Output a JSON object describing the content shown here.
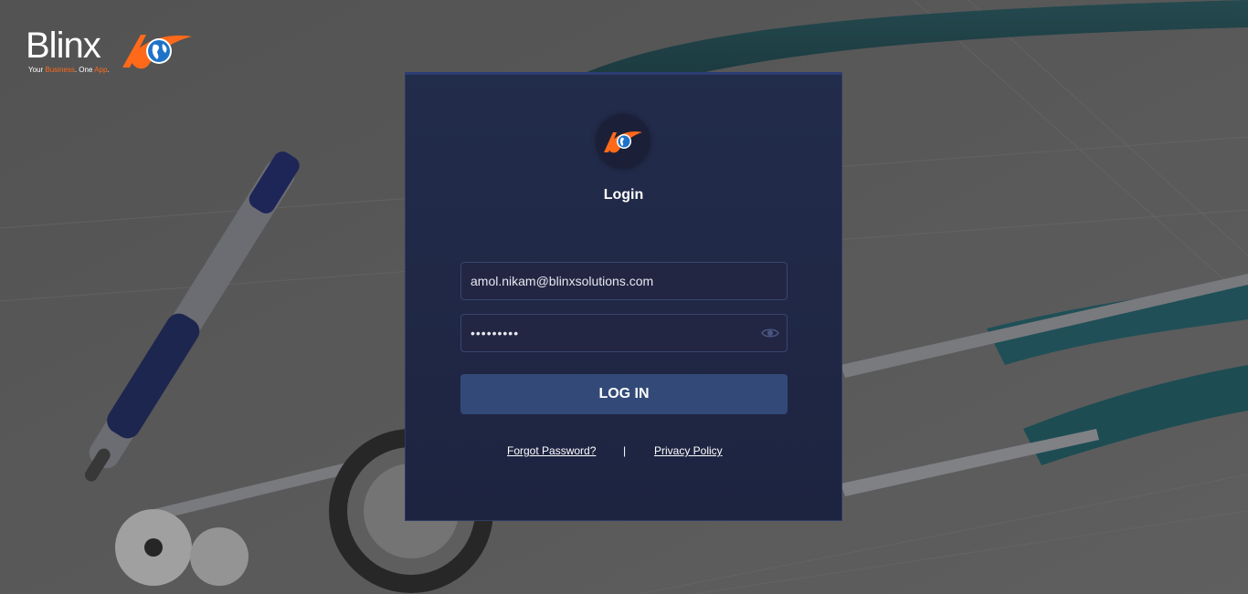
{
  "brand": {
    "name": "Blinx",
    "tagline_parts": [
      "Your ",
      "Business",
      ". One ",
      "App",
      "."
    ],
    "accent_color": "#ff6a1a",
    "globe_color": "#1e73c8"
  },
  "login": {
    "title": "Login",
    "email_value": "amol.nikam@blinxsolutions.com",
    "password_value": "password1",
    "submit_label": "LOG IN",
    "forgot_label": "Forgot Password?",
    "separator": "|",
    "privacy_label": "Privacy Policy",
    "icons": {
      "badge": "blinx-logo-icon",
      "toggle": "eye-icon"
    }
  },
  "theme": {
    "card_bg": "#222c4b",
    "button_bg": "#334a78",
    "input_bg": "#222643"
  }
}
